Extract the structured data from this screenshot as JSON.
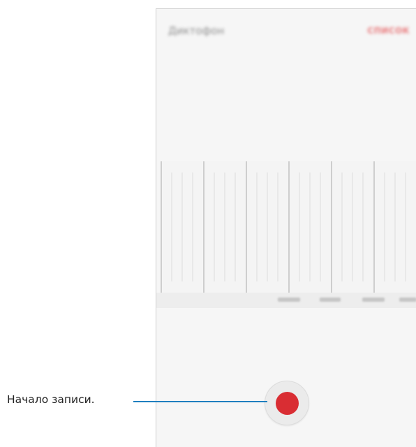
{
  "app": {
    "title": "Диктофон",
    "list_button": "СПИСОК"
  },
  "callout": {
    "label": "Начало записи."
  },
  "colors": {
    "record_red": "#d92d33",
    "callout_blue": "#1f7fbf",
    "accent_text": "#e8787a"
  },
  "icons": {
    "record": "record-icon"
  }
}
